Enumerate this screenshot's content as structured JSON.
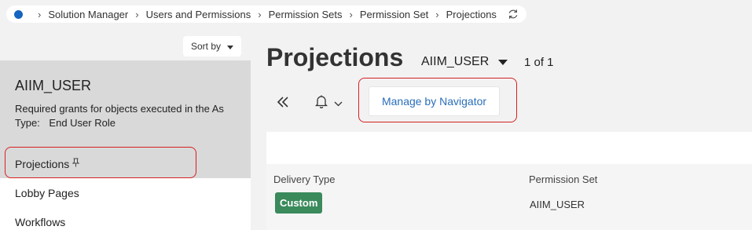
{
  "breadcrumb": {
    "items": [
      "Solution Manager",
      "Users and Permissions",
      "Permission Sets",
      "Permission Set",
      "Projections"
    ]
  },
  "left_panel": {
    "sort_label": "Sort by",
    "record": {
      "title": "AIIM_USER",
      "description": "Required grants for objects executed in the As",
      "type_label": "Type:",
      "type_value": "End User Role"
    },
    "nav_items": [
      {
        "label": "Projections",
        "active": true
      },
      {
        "label": "Lobby Pages",
        "active": false
      },
      {
        "label": "Workflows",
        "active": false
      }
    ]
  },
  "main": {
    "title": "Projections",
    "selector_value": "AIIM_USER",
    "pager": "1 of 1",
    "manage_button": "Manage by Navigator",
    "table": {
      "columns": [
        "Delivery Type",
        "Permission Set"
      ],
      "rows": [
        {
          "delivery_type": "Custom",
          "permission_set": "AIIM_USER"
        }
      ]
    }
  },
  "colors": {
    "accent": "#1565c0",
    "link": "#2a6ebb",
    "badge_green": "#3a8a5c",
    "highlight_red": "#d62020"
  }
}
